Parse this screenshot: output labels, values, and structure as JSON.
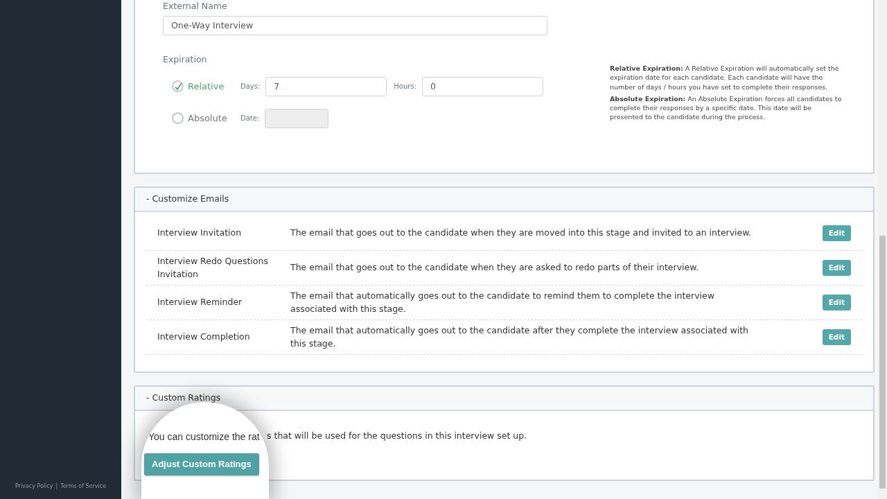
{
  "external_name": {
    "label": "External Name",
    "value": "One-Way Interview"
  },
  "expiration": {
    "label": "Expiration",
    "options": [
      {
        "label": "Relative",
        "selected": true,
        "fields": [
          {
            "label": "Days:",
            "value": "7",
            "disabled": false
          },
          {
            "label": "Hours:",
            "value": "0",
            "disabled": false
          }
        ]
      },
      {
        "label": "Absolute",
        "selected": false,
        "fields": [
          {
            "label": "Date:",
            "disabled": true
          }
        ]
      }
    ],
    "help": [
      {
        "term": "Relative Expiration:",
        "text": "A Relative Expiration will automatically set the expiration date for each candidate. Each candidate will have the number of days / hours you have set to complete their responses."
      },
      {
        "term": "Absolute Expiration:",
        "text": "An Absolute Expiration forces all candidates to complete their responses by a specific date. This date will be presented to the candidate during the process."
      }
    ]
  },
  "emails": {
    "title": "- Customize Emails",
    "rows": [
      {
        "name": "Interview Invitation",
        "description": "The email that goes out to the candidate when they are moved into this stage and invited to an interview.",
        "button": "Edit"
      },
      {
        "name": "Interview Redo Questions Invitation",
        "description": "The email that goes out to the candidate when they are asked to redo parts of their interview.",
        "button": "Edit"
      },
      {
        "name": "Interview Reminder",
        "description": "The email that automatically goes out to the candidate to remind them to complete the interview associated with this stage.",
        "button": "Edit"
      },
      {
        "name": "Interview Completion",
        "description": "The email that automatically goes out to the candidate after they complete the interview associated with this stage.",
        "button": "Edit"
      }
    ]
  },
  "ratings": {
    "title": "- Custom Ratings",
    "lens_text": "You can customize the rat",
    "text": "s that will be used for the questions in this interview set up.",
    "button": "Adjust Custom Ratings"
  },
  "footer": {
    "links": [
      "Privacy Policy",
      "Terms of Service"
    ],
    "separator": "|"
  }
}
